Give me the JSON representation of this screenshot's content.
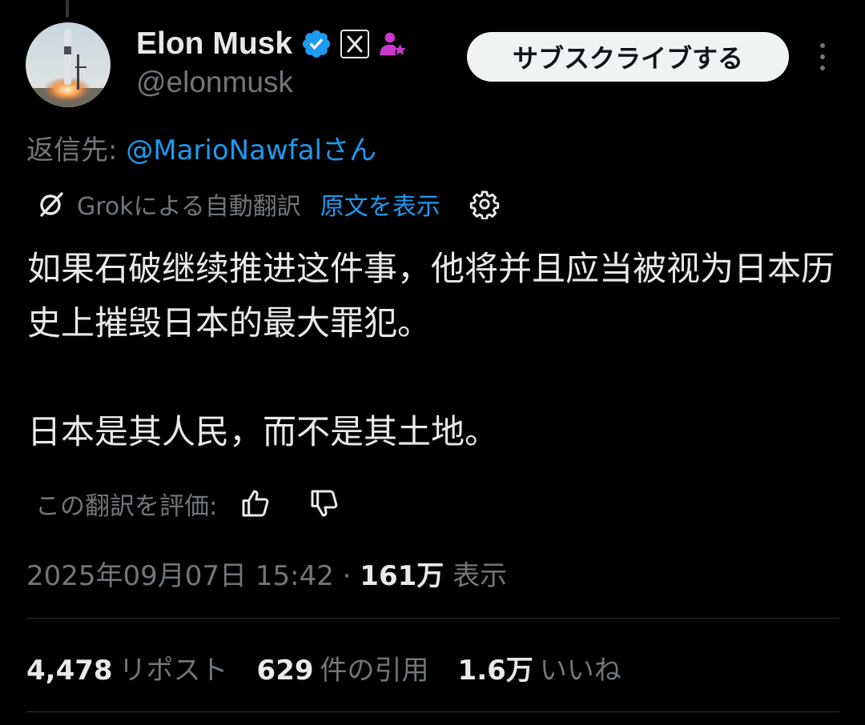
{
  "author": {
    "display_name": "Elon Musk",
    "handle": "@elonmusk",
    "verified_badge_icon": "verified-badge-icon",
    "affiliate_icon": "x-logo-icon",
    "subscriber_icon": "subscriber-person-icon"
  },
  "header": {
    "subscribe_label": "サブスクライブする",
    "more_icon": "more-vertical-icon"
  },
  "reply": {
    "prefix": "返信先: ",
    "mention": "@MarioNawfalさん"
  },
  "translation": {
    "icon": "grok-icon",
    "label": "Grokによる自動翻訳",
    "show_original": "原文を表示",
    "settings_icon": "gear-icon"
  },
  "tweet": {
    "paragraph1": " 如果石破继续推进这件事，他将并且应当被视为日本历史上摧毁日本的最大罪犯。",
    "paragraph2": "日本是其人民，而不是其土地。"
  },
  "rating": {
    "label": "この翻訳を評価: ",
    "thumbs_up_icon": "thumbs-up-icon",
    "thumbs_down_icon": "thumbs-down-icon"
  },
  "meta": {
    "datetime": "2025年09月07日 15:42",
    "separator": " · ",
    "views_count": "161万",
    "views_label": " 表示"
  },
  "stats": [
    {
      "count": "4,478",
      "label": "リポスト"
    },
    {
      "count": "629",
      "label": "件の引用"
    },
    {
      "count": "1.6万",
      "label": "いいね"
    }
  ],
  "colors": {
    "background": "#000000",
    "primary_text": "#e7e9ea",
    "secondary_text": "#71767b",
    "link": "#1d9bf0",
    "divider": "#2f3336",
    "subscriber_badge": "#c936c9"
  }
}
